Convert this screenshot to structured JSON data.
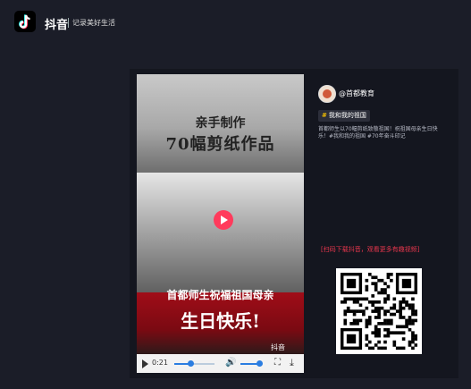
{
  "header": {
    "brand": "抖音",
    "slogan": "记录美好生活"
  },
  "video": {
    "caption_line1": "亲手制作",
    "caption_line2": "70幅剪纸作品",
    "caption_line3": "首都师生祝福祖国母亲",
    "caption_line4": "生日快乐!",
    "watermark": "抖音",
    "controls": {
      "time": "0:21",
      "progress": 0.4,
      "volume": 1.0
    }
  },
  "author": {
    "username": "@首都教育"
  },
  "tag": {
    "label": "我和我的祖国"
  },
  "description": "首都师生以70幅剪纸致敬祖国！祝祖国母亲生日快乐！#我和我的祖国 #70年奋斗印记",
  "promo_text": "[扫码下载抖音，观看更多有趣视频]",
  "colors": {
    "background": "#1b1d28",
    "accent_red": "#e8364d",
    "player_blue": "#2a7de1",
    "tag_hash": "#f5c000"
  },
  "icons": {
    "logo": "tiktok-logo-icon",
    "play": "play-icon",
    "volume": "volume-icon",
    "fullscreen": "fullscreen-icon",
    "download": "download-icon"
  }
}
